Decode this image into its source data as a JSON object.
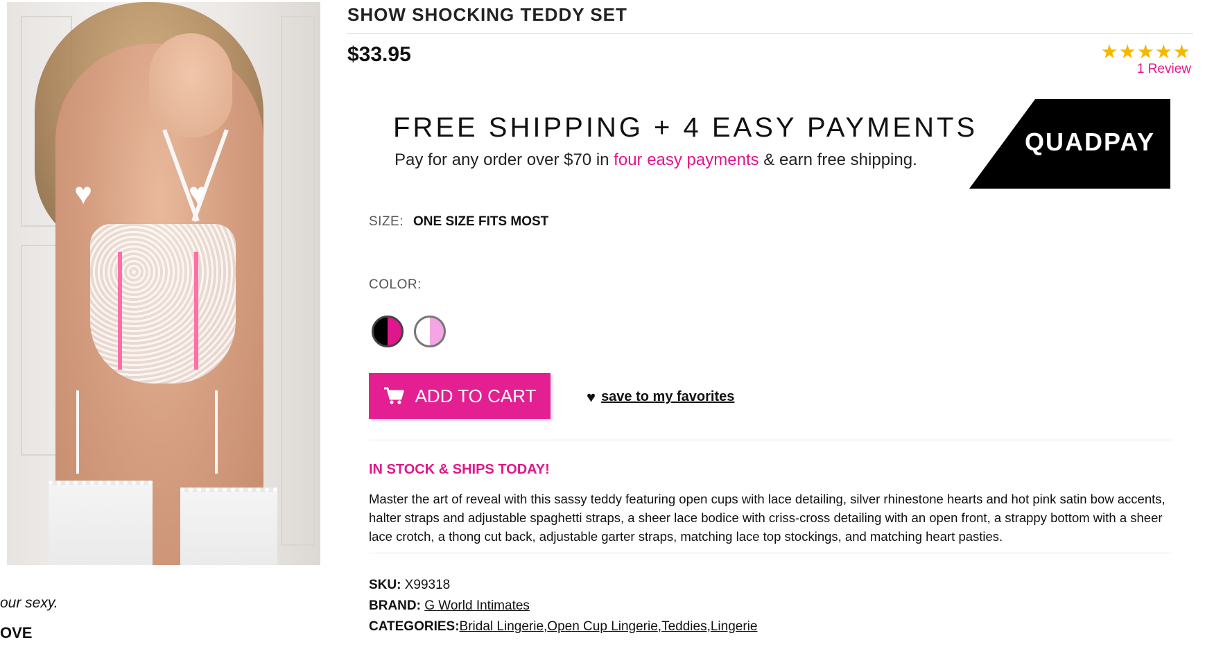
{
  "product": {
    "title": "SHOW SHOCKING TEDDY SET",
    "price": "$33.95",
    "rating": {
      "stars": "★★★★★",
      "value": 5,
      "max": 5,
      "reviews_label": "1 Review"
    }
  },
  "quadpay": {
    "headline": "FREE SHIPPING + 4 EASY PAYMENTS",
    "sub_before": "Pay for any order over $70 in ",
    "sub_accent": "four easy payments",
    "sub_after": " & earn free shipping.",
    "logo": "QUADPAY"
  },
  "options": {
    "size_label": "SIZE:",
    "size_value": "ONE SIZE FITS MOST",
    "color_label": "COLOR:",
    "colors": [
      {
        "left": "#000000",
        "right": "#e0168c"
      },
      {
        "left": "#ffffff",
        "right": "#f3a6e3"
      }
    ]
  },
  "actions": {
    "add_to_cart": "ADD TO CART",
    "favorites": "save to my favorites",
    "cart_icon": "shopping-cart-icon",
    "heart_icon": "heart-icon"
  },
  "stock_status": "IN STOCK & SHIPS TODAY!",
  "description": "Master the art of reveal with this sassy teddy featuring open cups with lace detailing, silver rhinestone hearts and hot pink satin bow accents, halter straps and adjustable spaghetti straps, a sheer lace bodice with criss-cross detailing with an open front, a strappy bottom with a sheer lace crotch, a thong cut back, adjustable garter straps, matching lace top stockings, and matching heart pasties.",
  "meta": {
    "sku_label": "SKU:",
    "sku_value": "X99318",
    "brand_label": "BRAND:",
    "brand_value": "G World Intimates",
    "categories_label": "CATEGORIES:",
    "categories": [
      "Bridal Lingerie",
      "Open Cup Lingerie",
      "Teddies",
      "Lingerie"
    ]
  },
  "left_partial": {
    "line1": "our sexy.",
    "line2": "OVE"
  },
  "colors": {
    "accent": "#e0168c",
    "button": "#e31f92",
    "star": "#f5b800"
  }
}
